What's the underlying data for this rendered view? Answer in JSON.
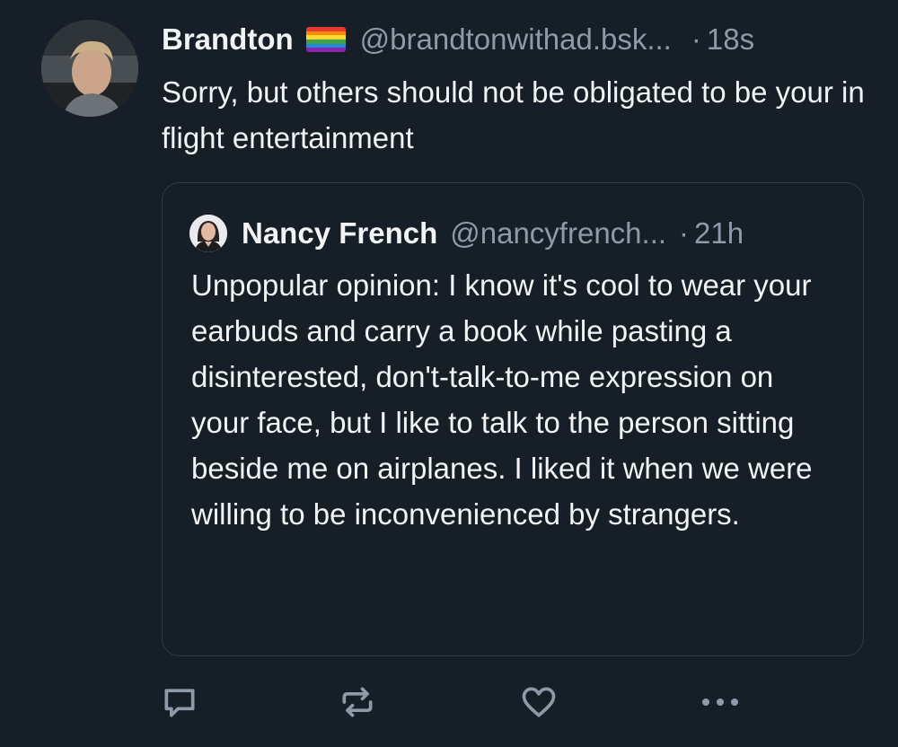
{
  "post": {
    "author": {
      "display_name": "Brandton",
      "handle": "@brandtonwithad.bsk...",
      "separator": "·",
      "time": "18s",
      "flag_icon": "rainbow-flag-icon"
    },
    "text": "Sorry, but others should not be obligated to be your in flight entertainment"
  },
  "quote": {
    "author": {
      "display_name": "Nancy French",
      "handle": "@nancyfrench...",
      "separator": "·",
      "time": "21h"
    },
    "text": "Unpopular opinion: I know it's cool to wear your earbuds and carry a book while pasting a disinterested, don't-talk-to-me expression on your face, but I like to talk to the person sitting beside me on airplanes. I liked it when we were willing to be inconvenienced by strangers."
  },
  "actions": {
    "reply_icon": "reply-icon",
    "repost_icon": "repost-icon",
    "like_icon": "heart-icon",
    "more_icon": "more-icon"
  },
  "colors": {
    "background": "#161e27",
    "text": "#f1f3f5",
    "muted": "#8d9aa9",
    "border": "#2e3a47"
  }
}
